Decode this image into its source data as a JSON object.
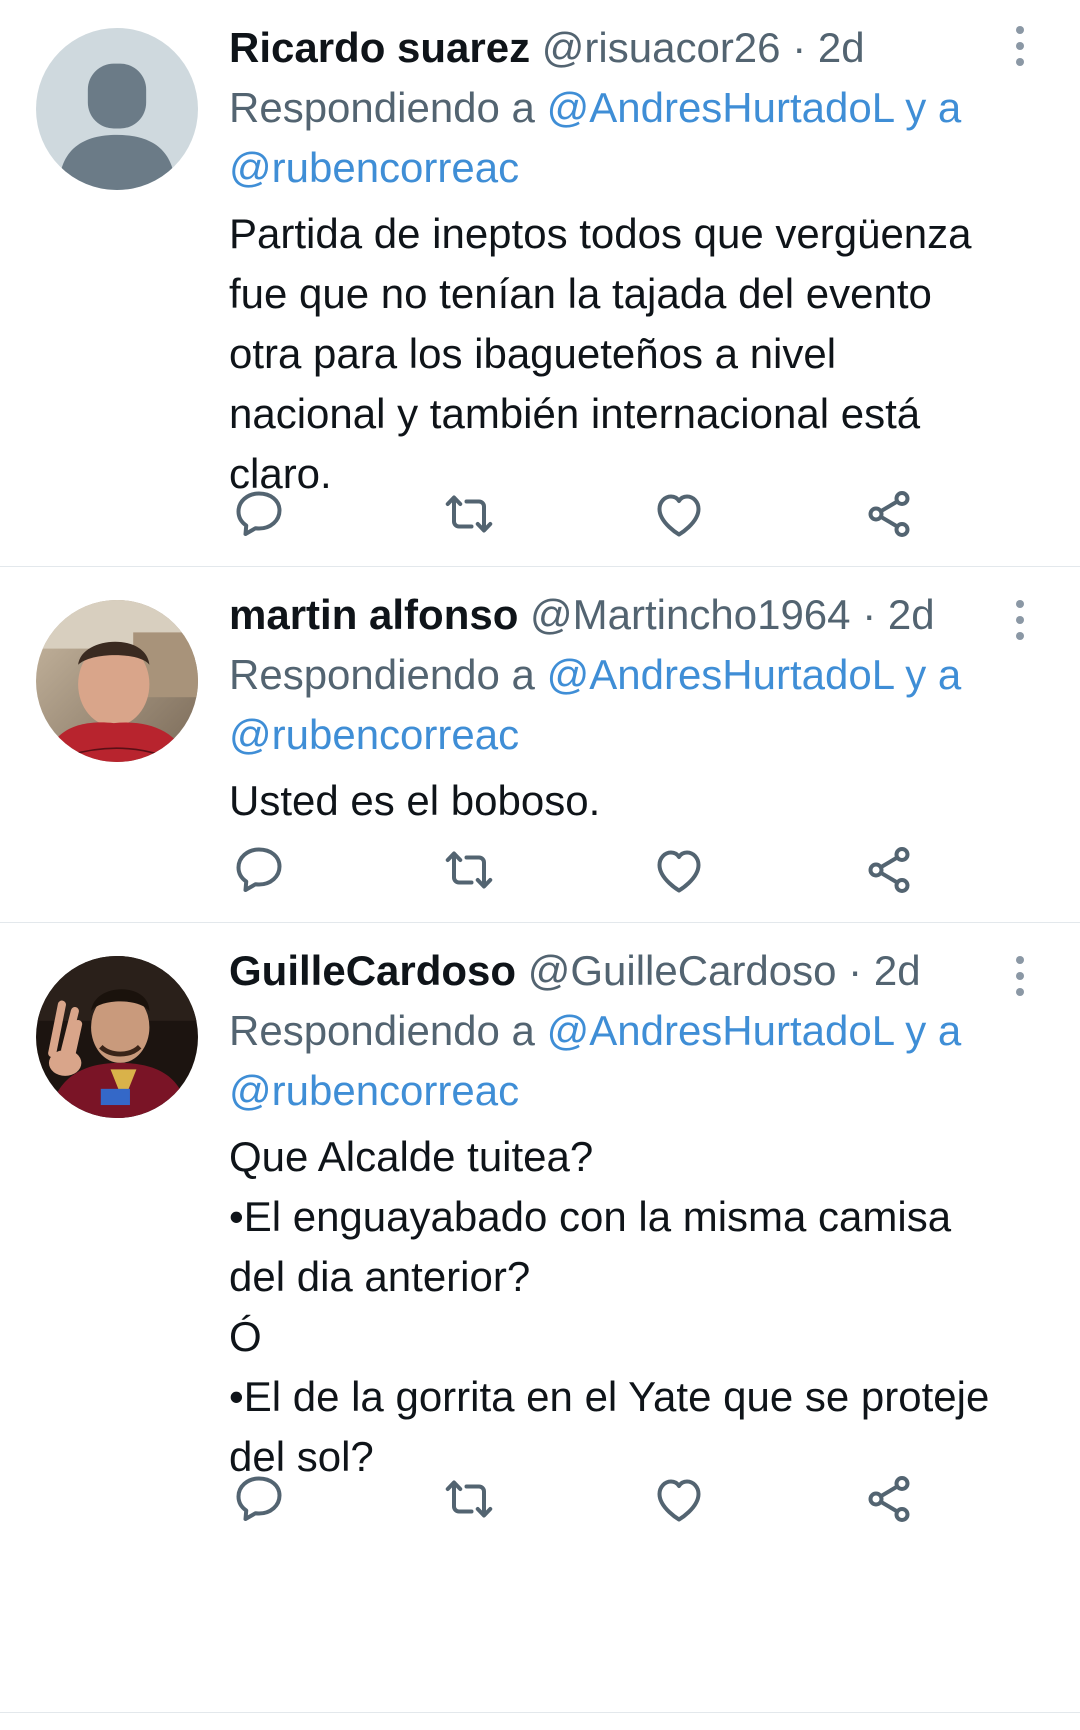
{
  "tweets": [
    {
      "name": "Ricardo suarez",
      "handle": "@risuacor26",
      "dot": "·",
      "time": "2d",
      "reply_prefix": "Respondiendo a",
      "reply_mention_1": "@AndresHurtadoL",
      "reply_connector": "y a",
      "reply_mention_2": "@rubencorreac",
      "lines": [
        "Partida de ineptos todos que vergüenza",
        "fue que no tenían la tajada del evento",
        "otra para los ibagueteños a nivel",
        "nacional y también internacional está",
        "claro."
      ],
      "avatar": "default-avatar"
    },
    {
      "name": "martin alfonso",
      "handle": "@Martincho1964",
      "dot": "·",
      "time": "2d",
      "reply_prefix": "Respondiendo a",
      "reply_mention_1": "@AndresHurtadoL",
      "reply_connector": "y a",
      "reply_mention_2": "@rubencorreac",
      "lines": [
        "Usted es el boboso."
      ],
      "avatar": "photo-avatar"
    },
    {
      "name": "GuilleCardoso",
      "handle": "@GuilleCardoso",
      "dot": "·",
      "time": "2d",
      "reply_prefix": "Respondiendo a",
      "reply_mention_1": "@AndresHurtadoL",
      "reply_connector": "y a",
      "reply_mention_2": "@rubencorreac",
      "lines": [
        "Que Alcalde tuitea?",
        "•El enguayabado con la misma camisa",
        "del dia anterior?",
        "Ó",
        "•El de la gorrita en el Yate que se proteje",
        "del sol?"
      ],
      "avatar": "photo-avatar"
    }
  ],
  "colors": {
    "mention": "#3f8ed6",
    "secondary_text": "#536471",
    "icon": "#536471",
    "divider": "#e3e8ec"
  },
  "icons": {
    "reply": "reply-icon",
    "retweet": "retweet-icon",
    "like": "like-icon",
    "share": "share-icon",
    "more": "more-options-icon"
  }
}
